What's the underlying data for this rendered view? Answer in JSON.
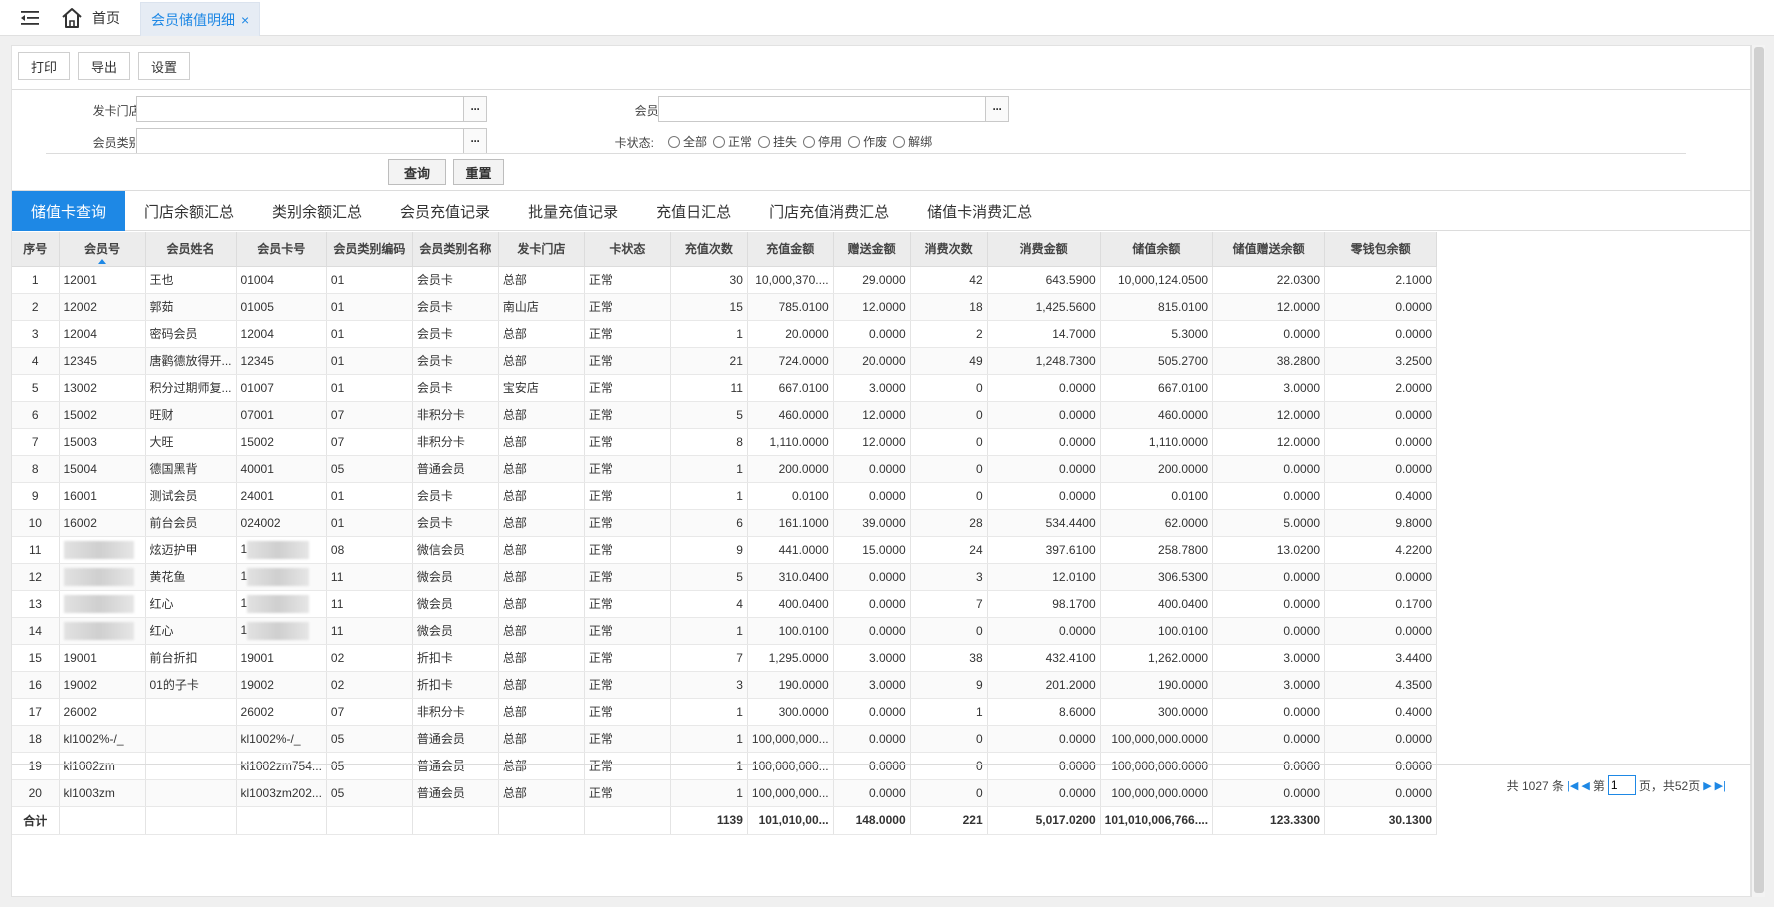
{
  "topbar": {
    "home_label": "首页",
    "active_tab_label": "会员储值明细",
    "close_symbol": "×"
  },
  "toolbar": {
    "print_label": "打印",
    "export_label": "导出",
    "settings_label": "设置"
  },
  "filters": {
    "store_label": "发卡门店:",
    "store_value": "",
    "member_label": "会员:",
    "member_value": "",
    "category_label": "会员类别:",
    "category_value": "",
    "card_status_label": "卡状态:",
    "card_status_options": [
      "全部",
      "正常",
      "挂失",
      "停用",
      "作废",
      "解绑"
    ],
    "dots": "···",
    "query_label": "查询",
    "reset_label": "重置"
  },
  "subtabs": [
    "储值卡查询",
    "门店余额汇总",
    "类别余额汇总",
    "会员充值记录",
    "批量充值记录",
    "充值日汇总",
    "门店充值消费汇总",
    "储值卡消费汇总"
  ],
  "columns": [
    "序号",
    "会员号",
    "会员姓名",
    "会员卡号",
    "会员类别编码",
    "会员类别名称",
    "发卡门店",
    "卡状态",
    "充值次数",
    "充值金额",
    "赠送金额",
    "消费次数",
    "消费金额",
    "储值余额",
    "储值赠送余额",
    "零钱包余额"
  ],
  "rows": [
    [
      "1",
      "12001",
      "王也",
      "01004",
      "01",
      "会员卡",
      "总部",
      "正常",
      "30",
      "10,000,370....",
      "29.0000",
      "42",
      "643.5900",
      "10,000,124.0500",
      "22.0300",
      "2.1000"
    ],
    [
      "2",
      "12002",
      "郭茹",
      "01005",
      "01",
      "会员卡",
      "南山店",
      "正常",
      "15",
      "785.0100",
      "12.0000",
      "18",
      "1,425.5600",
      "815.0100",
      "12.0000",
      "0.0000"
    ],
    [
      "3",
      "12004",
      "密码会员",
      "12004",
      "01",
      "会员卡",
      "总部",
      "正常",
      "1",
      "20.0000",
      "0.0000",
      "2",
      "14.7000",
      "5.3000",
      "0.0000",
      "0.0000"
    ],
    [
      "4",
      "12345",
      "唐鹳德放得开...",
      "12345",
      "01",
      "会员卡",
      "总部",
      "正常",
      "21",
      "724.0000",
      "20.0000",
      "49",
      "1,248.7300",
      "505.2700",
      "38.2800",
      "3.2500"
    ],
    [
      "5",
      "13002",
      "积分过期师复...",
      "01007",
      "01",
      "会员卡",
      "宝安店",
      "正常",
      "11",
      "667.0100",
      "3.0000",
      "0",
      "0.0000",
      "667.0100",
      "3.0000",
      "2.0000"
    ],
    [
      "6",
      "15002",
      "旺财",
      "07001",
      "07",
      "非积分卡",
      "总部",
      "正常",
      "5",
      "460.0000",
      "12.0000",
      "0",
      "0.0000",
      "460.0000",
      "12.0000",
      "0.0000"
    ],
    [
      "7",
      "15003",
      "大旺",
      "15002",
      "07",
      "非积分卡",
      "总部",
      "正常",
      "8",
      "1,110.0000",
      "12.0000",
      "0",
      "0.0000",
      "1,110.0000",
      "12.0000",
      "0.0000"
    ],
    [
      "8",
      "15004",
      "德国黑背",
      "40001",
      "05",
      "普通会员",
      "总部",
      "正常",
      "1",
      "200.0000",
      "0.0000",
      "0",
      "0.0000",
      "200.0000",
      "0.0000",
      "0.0000"
    ],
    [
      "9",
      "16001",
      "测试会员",
      "24001",
      "01",
      "会员卡",
      "总部",
      "正常",
      "1",
      "0.0100",
      "0.0000",
      "0",
      "0.0000",
      "0.0100",
      "0.0000",
      "0.4000"
    ],
    [
      "10",
      "16002",
      "前台会员",
      "024002",
      "01",
      "会员卡",
      "总部",
      "正常",
      "6",
      "161.1000",
      "39.0000",
      "28",
      "534.4400",
      "62.0000",
      "5.0000",
      "9.8000"
    ],
    [
      "11",
      "",
      "炫迈护甲",
      "1",
      "08",
      "微信会员",
      "总部",
      "正常",
      "9",
      "441.0000",
      "15.0000",
      "24",
      "397.6100",
      "258.7800",
      "13.0200",
      "4.2200"
    ],
    [
      "12",
      "",
      "黄花鱼",
      "1",
      "11",
      "微会员",
      "总部",
      "正常",
      "5",
      "310.0400",
      "0.0000",
      "3",
      "12.0100",
      "306.5300",
      "0.0000",
      "0.0000"
    ],
    [
      "13",
      "",
      "红心",
      "1",
      "11",
      "微会员",
      "总部",
      "正常",
      "4",
      "400.0400",
      "0.0000",
      "7",
      "98.1700",
      "400.0400",
      "0.0000",
      "0.1700"
    ],
    [
      "14",
      "",
      "红心",
      "1",
      "11",
      "微会员",
      "总部",
      "正常",
      "1",
      "100.0100",
      "0.0000",
      "0",
      "0.0000",
      "100.0100",
      "0.0000",
      "0.0000"
    ],
    [
      "15",
      "19001",
      "前台折扣",
      "19001",
      "02",
      "折扣卡",
      "总部",
      "正常",
      "7",
      "1,295.0000",
      "3.0000",
      "38",
      "432.4100",
      "1,262.0000",
      "3.0000",
      "3.4400"
    ],
    [
      "16",
      "19002",
      "01的子卡",
      "19002",
      "02",
      "折扣卡",
      "总部",
      "正常",
      "3",
      "190.0000",
      "3.0000",
      "9",
      "201.2000",
      "190.0000",
      "3.0000",
      "4.3500"
    ],
    [
      "17",
      "26002",
      "",
      "26002",
      "07",
      "非积分卡",
      "总部",
      "正常",
      "1",
      "300.0000",
      "0.0000",
      "1",
      "8.6000",
      "300.0000",
      "0.0000",
      "0.4000"
    ],
    [
      "18",
      "kl1002%-/_",
      "",
      "kl1002%-/_",
      "05",
      "普通会员",
      "总部",
      "正常",
      "1",
      "100,000,000...",
      "0.0000",
      "0",
      "0.0000",
      "100,000,000.0000",
      "0.0000",
      "0.0000"
    ],
    [
      "19",
      "kl1002zm",
      "",
      "kl1002zm754...",
      "05",
      "普通会员",
      "总部",
      "正常",
      "1",
      "100,000,000...",
      "0.0000",
      "0",
      "0.0000",
      "100,000,000.0000",
      "0.0000",
      "0.0000"
    ],
    [
      "20",
      "kl1003zm",
      "",
      "kl1003zm202...",
      "05",
      "普通会员",
      "总部",
      "正常",
      "1",
      "100,000,000...",
      "0.0000",
      "0",
      "0.0000",
      "100,000,000.0000",
      "0.0000",
      "0.0000"
    ]
  ],
  "totals": [
    "合计",
    "",
    "",
    "",
    "",
    "",
    "",
    "",
    "1139",
    "101,010,00...",
    "148.0000",
    "221",
    "5,017.0200",
    "101,010,006,766....",
    "123.3300",
    "30.1300"
  ],
  "pager": {
    "total_text": "共 1027 条",
    "page_prefix": "第",
    "current_page": "1",
    "page_suffix": "页，共52页"
  },
  "colors": {
    "accent": "#1e88e5",
    "header_bg": "#ececec"
  }
}
